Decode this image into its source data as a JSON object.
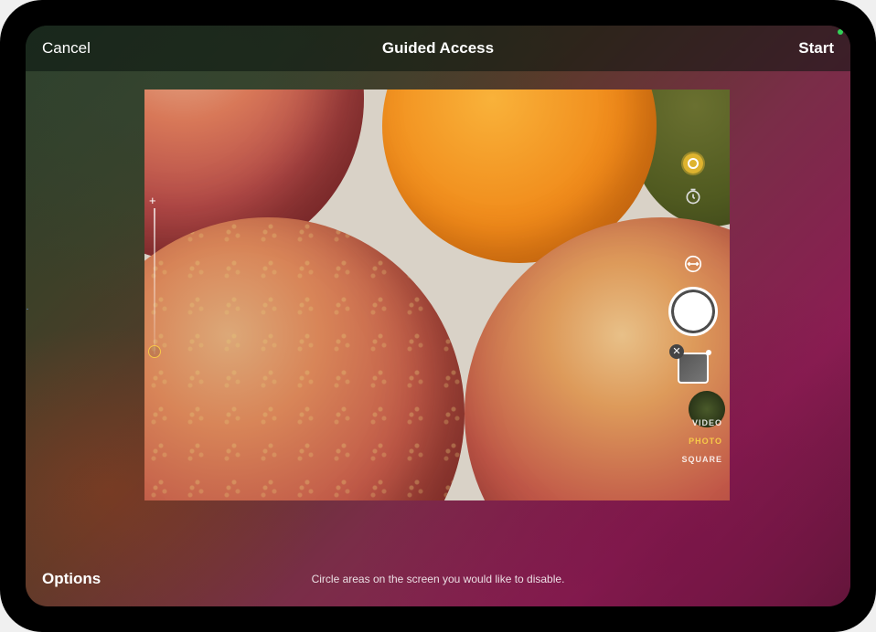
{
  "topbar": {
    "cancel_label": "Cancel",
    "title": "Guided Access",
    "start_label": "Start"
  },
  "bottombar": {
    "options_label": "Options",
    "hint_text": "Circle areas on the screen you would like to disable."
  },
  "camera": {
    "modes": {
      "video": "VIDEO",
      "photo": "PHOTO",
      "square": "SQUARE"
    },
    "active_mode": "photo"
  }
}
